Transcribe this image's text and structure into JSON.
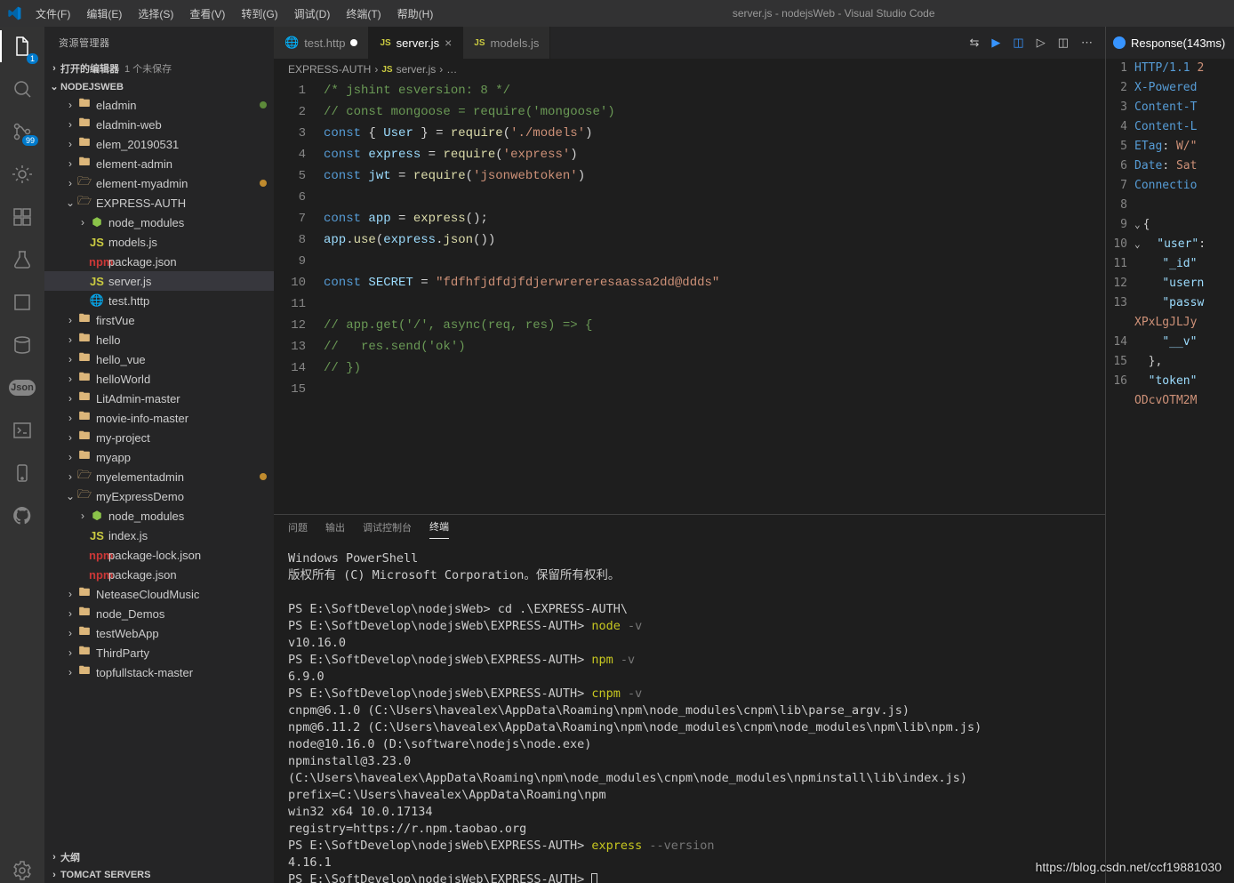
{
  "window": {
    "title": "server.js - nodejsWeb - Visual Studio Code"
  },
  "menu": [
    "文件(F)",
    "编辑(E)",
    "选择(S)",
    "查看(V)",
    "转到(G)",
    "调试(D)",
    "终端(T)",
    "帮助(H)"
  ],
  "activity_badge": "99",
  "sidebar": {
    "title": "资源管理器",
    "sections": {
      "open_editors": {
        "label": "打开的编辑器",
        "extra": "1 个未保存"
      },
      "workspace": "NODEJSWEB",
      "outline": "大纲",
      "tomcat": "TOMCAT SERVERS"
    },
    "tree": [
      {
        "indent": 1,
        "chev": "›",
        "icon": "folder",
        "label": "eladmin",
        "dot": "#5d8a3a"
      },
      {
        "indent": 1,
        "chev": "›",
        "icon": "folder",
        "label": "eladmin-web"
      },
      {
        "indent": 1,
        "chev": "›",
        "icon": "folder",
        "label": "elem_20190531"
      },
      {
        "indent": 1,
        "chev": "›",
        "icon": "folder",
        "label": "element-admin"
      },
      {
        "indent": 1,
        "chev": "›",
        "icon": "folder-open",
        "label": "element-myadmin",
        "dot": "#c08b2e"
      },
      {
        "indent": 1,
        "chev": "⌄",
        "icon": "folder-open",
        "label": "EXPRESS-AUTH"
      },
      {
        "indent": 2,
        "chev": "›",
        "icon": "node-mod",
        "label": "node_modules"
      },
      {
        "indent": 2,
        "chev": "",
        "icon": "js",
        "label": "models.js"
      },
      {
        "indent": 2,
        "chev": "",
        "icon": "npm",
        "label": "package.json"
      },
      {
        "indent": 2,
        "chev": "",
        "icon": "js",
        "label": "server.js",
        "selected": true
      },
      {
        "indent": 2,
        "chev": "",
        "icon": "http",
        "label": "test.http"
      },
      {
        "indent": 1,
        "chev": "›",
        "icon": "folder",
        "label": "firstVue"
      },
      {
        "indent": 1,
        "chev": "›",
        "icon": "folder",
        "label": "hello"
      },
      {
        "indent": 1,
        "chev": "›",
        "icon": "folder",
        "label": "hello_vue"
      },
      {
        "indent": 1,
        "chev": "›",
        "icon": "folder",
        "label": "helloWorld"
      },
      {
        "indent": 1,
        "chev": "›",
        "icon": "folder",
        "label": "LitAdmin-master"
      },
      {
        "indent": 1,
        "chev": "›",
        "icon": "folder",
        "label": "movie-info-master"
      },
      {
        "indent": 1,
        "chev": "›",
        "icon": "folder",
        "label": "my-project"
      },
      {
        "indent": 1,
        "chev": "›",
        "icon": "folder",
        "label": "myapp"
      },
      {
        "indent": 1,
        "chev": "›",
        "icon": "folder-open",
        "label": "myelementadmin",
        "dot": "#c08b2e"
      },
      {
        "indent": 1,
        "chev": "⌄",
        "icon": "folder-open",
        "label": "myExpressDemo"
      },
      {
        "indent": 2,
        "chev": "›",
        "icon": "node-mod",
        "label": "node_modules"
      },
      {
        "indent": 2,
        "chev": "",
        "icon": "js",
        "label": "index.js"
      },
      {
        "indent": 2,
        "chev": "",
        "icon": "npm",
        "label": "package-lock.json"
      },
      {
        "indent": 2,
        "chev": "",
        "icon": "npm",
        "label": "package.json"
      },
      {
        "indent": 1,
        "chev": "›",
        "icon": "folder",
        "label": "NeteaseCloudMusic"
      },
      {
        "indent": 1,
        "chev": "›",
        "icon": "folder",
        "label": "node_Demos"
      },
      {
        "indent": 1,
        "chev": "›",
        "icon": "folder",
        "label": "testWebApp"
      },
      {
        "indent": 1,
        "chev": "›",
        "icon": "folder",
        "label": "ThirdParty"
      },
      {
        "indent": 1,
        "chev": "›",
        "icon": "folder",
        "label": "topfullstack-master"
      }
    ]
  },
  "tabs": [
    {
      "icon": "http",
      "label": "test.http",
      "modified": true
    },
    {
      "icon": "js",
      "label": "server.js",
      "active": true,
      "close": true
    },
    {
      "icon": "js",
      "label": "models.js"
    }
  ],
  "breadcrumb": {
    "root": "EXPRESS-AUTH",
    "file": "server.js",
    "rest": "…"
  },
  "code": {
    "lines": [
      {
        "n": 1,
        "html": "<span class='c-comment'>/* jshint esversion: 8 */</span>"
      },
      {
        "n": 2,
        "html": "<span class='c-comment'>// const mongoose = require('mongoose')</span>"
      },
      {
        "n": 3,
        "html": "<span class='c-keyword'>const</span> <span class='c-punct'>{</span> <span class='c-var'>User</span> <span class='c-punct'>}</span> <span class='c-punct'>=</span> <span class='c-func'>require</span><span class='c-punct'>(</span><span class='c-string'>'./models'</span><span class='c-punct'>)</span>"
      },
      {
        "n": 4,
        "html": "<span class='c-keyword'>const</span> <span class='c-var'>express</span> <span class='c-punct'>=</span> <span class='c-func'>require</span><span class='c-punct'>(</span><span class='c-string'>'express'</span><span class='c-punct'>)</span>"
      },
      {
        "n": 5,
        "html": "<span class='c-keyword'>const</span> <span class='c-var'>jwt</span> <span class='c-punct'>=</span> <span class='c-func'>require</span><span class='c-punct'>(</span><span class='c-string'>'jsonwebtoken'</span><span class='c-punct'>)</span>"
      },
      {
        "n": 6,
        "html": ""
      },
      {
        "n": 7,
        "html": "<span class='c-keyword'>const</span> <span class='c-var'>app</span> <span class='c-punct'>=</span> <span class='c-func'>express</span><span class='c-punct'>();</span>"
      },
      {
        "n": 8,
        "html": "<span class='c-var'>app</span><span class='c-punct'>.</span><span class='c-func'>use</span><span class='c-punct'>(</span><span class='c-var'>express</span><span class='c-punct'>.</span><span class='c-func'>json</span><span class='c-punct'>())</span>"
      },
      {
        "n": 9,
        "html": ""
      },
      {
        "n": 10,
        "html": "<span class='c-keyword'>const</span> <span class='c-var'>SECRET</span> <span class='c-punct'>=</span> <span class='c-string'>\"fdfhfjdfdjfdjerwrereresaassa2dd@ddds\"</span>"
      },
      {
        "n": 11,
        "html": ""
      },
      {
        "n": 12,
        "html": "<span class='c-comment'>// app.get('/', async(req, res) =&gt; {</span>"
      },
      {
        "n": 13,
        "html": "<span class='c-comment'>//   res.send('ok')</span>"
      },
      {
        "n": 14,
        "html": "<span class='c-comment'>// })</span>"
      },
      {
        "n": 15,
        "html": ""
      }
    ]
  },
  "panel": {
    "tabs": [
      "问题",
      "输出",
      "调试控制台",
      "终端"
    ],
    "active": "终端"
  },
  "terminal": {
    "lines": [
      {
        "t": "Windows PowerShell"
      },
      {
        "t": "版权所有 (C) Microsoft Corporation。保留所有权利。"
      },
      {
        "t": ""
      },
      {
        "prompt": "PS E:\\SoftDevelop\\nodejsWeb> ",
        "cmd": "cd .\\EXPRESS-AUTH\\"
      },
      {
        "prompt": "PS E:\\SoftDevelop\\nodejsWeb\\EXPRESS-AUTH> ",
        "cmdY": "node",
        "arg": " -v"
      },
      {
        "t": "v10.16.0"
      },
      {
        "prompt": "PS E:\\SoftDevelop\\nodejsWeb\\EXPRESS-AUTH> ",
        "cmdY": "npm",
        "arg": " -v"
      },
      {
        "t": "6.9.0"
      },
      {
        "prompt": "PS E:\\SoftDevelop\\nodejsWeb\\EXPRESS-AUTH> ",
        "cmdY": "cnpm",
        "arg": " -v"
      },
      {
        "t": "cnpm@6.1.0 (C:\\Users\\havealex\\AppData\\Roaming\\npm\\node_modules\\cnpm\\lib\\parse_argv.js)"
      },
      {
        "t": "npm@6.11.2 (C:\\Users\\havealex\\AppData\\Roaming\\npm\\node_modules\\cnpm\\node_modules\\npm\\lib\\npm.js)"
      },
      {
        "t": "node@10.16.0 (D:\\software\\nodejs\\node.exe)"
      },
      {
        "t": "npminstall@3.23.0 (C:\\Users\\havealex\\AppData\\Roaming\\npm\\node_modules\\cnpm\\node_modules\\npminstall\\lib\\index.js)"
      },
      {
        "t": "prefix=C:\\Users\\havealex\\AppData\\Roaming\\npm"
      },
      {
        "t": "win32 x64 10.0.17134"
      },
      {
        "t": "registry=https://r.npm.taobao.org"
      },
      {
        "prompt": "PS E:\\SoftDevelop\\nodejsWeb\\EXPRESS-AUTH> ",
        "cmdY": "express",
        "arg": " --version"
      },
      {
        "t": "4.16.1"
      },
      {
        "prompt": "PS E:\\SoftDevelop\\nodejsWeb\\EXPRESS-AUTH> ",
        "cursor": true
      }
    ]
  },
  "response": {
    "tab": "Response(143ms)",
    "lines": [
      {
        "n": 1,
        "html": "<span class='r-head'>HTTP/1.1</span> <span class='r-val'>2</span>"
      },
      {
        "n": 2,
        "html": "<span class='r-head'>X-Powered</span>"
      },
      {
        "n": 3,
        "html": "<span class='r-head'>Content-T</span>"
      },
      {
        "n": 4,
        "html": "<span class='r-head'>Content-L</span>"
      },
      {
        "n": 5,
        "html": "<span class='r-head'>ETag</span>: <span class='r-val'>W/\"</span>"
      },
      {
        "n": 6,
        "html": "<span class='r-head'>Date</span>: <span class='r-val'>Sat</span>"
      },
      {
        "n": 7,
        "html": "<span class='r-head'>Connectio</span>"
      },
      {
        "n": 8,
        "html": ""
      },
      {
        "n": 9,
        "fold": "⌄",
        "html": "{"
      },
      {
        "n": 10,
        "fold": "⌄",
        "html": "  <span class='r-key'>\"user\"</span>:"
      },
      {
        "n": 11,
        "html": "    <span class='r-key'>\"_id\"</span>"
      },
      {
        "n": 12,
        "html": "    <span class='r-key'>\"usern</span>"
      },
      {
        "n": 13,
        "html": "    <span class='r-key'>\"passw</span>"
      },
      {
        "n": "",
        "html": "<span class='r-val'>XPxLgJLJy</span>"
      },
      {
        "n": 14,
        "html": "    <span class='r-key'>\"__v\"</span>"
      },
      {
        "n": 15,
        "html": "  },"
      },
      {
        "n": 16,
        "html": "  <span class='r-key'>\"token\"</span>"
      },
      {
        "n": "",
        "html": "<span class='r-val'>ODcvOTM2M</span>"
      }
    ]
  },
  "watermark": "https://blog.csdn.net/ccf19881030"
}
